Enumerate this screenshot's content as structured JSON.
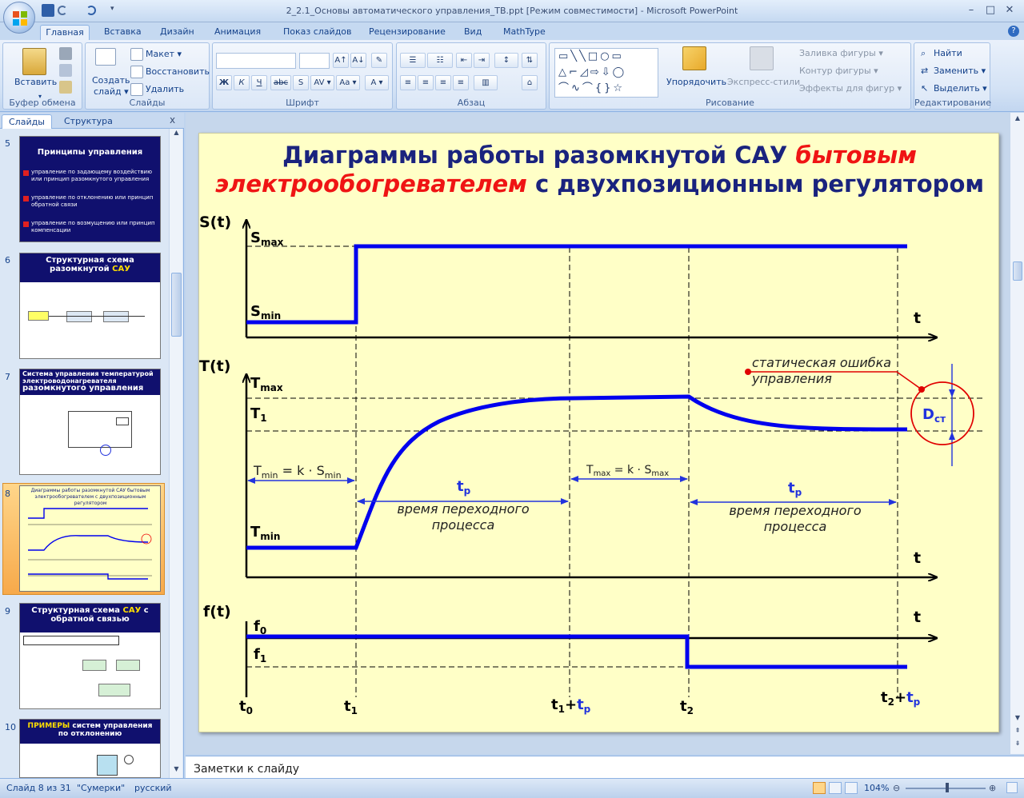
{
  "window": {
    "title": "2_2.1_Основы автоматического управления_ТВ.ppt [Режим совместимости] - Microsoft PowerPoint",
    "controls": [
      "–",
      "□",
      "✕"
    ]
  },
  "ribbon_tabs": [
    "Главная",
    "Вставка",
    "Дизайн",
    "Анимация",
    "Показ слайдов",
    "Рецензирование",
    "Вид",
    "MathType"
  ],
  "ribbon": {
    "clipboard": {
      "paste": "Вставить",
      "label": "Буфер обмена"
    },
    "slides": {
      "new_slide": "Создать",
      "new_slide2": "слайд ▾",
      "layout": "Макет ▾",
      "reset": "Восстановить",
      "delete": "Удалить",
      "label": "Слайды"
    },
    "font": {
      "bold": "Ж",
      "italic": "К",
      "underline": "Ч",
      "strike": "abc",
      "shadow": "S",
      "spacing": "AV ▾",
      "case": "Aa ▾",
      "color": "A ▾",
      "grow": "A↑",
      "shrink": "A↓",
      "clear": "✎",
      "label": "Шрифт"
    },
    "paragraph": {
      "label": "Абзац"
    },
    "drawing": {
      "arrange": "Упорядочить",
      "quick_styles": "Экспресс-стили",
      "fill": "Заливка фигуры ▾",
      "outline": "Контур фигуры ▾",
      "effects": "Эффекты для фигур ▾",
      "label": "Рисование"
    },
    "editing": {
      "find": "Найти",
      "replace": "Заменить ▾",
      "select": "Выделить ▾",
      "label": "Редактирование"
    }
  },
  "panel": {
    "tabs": [
      "Слайды",
      "Структура"
    ],
    "close": "x",
    "thumbnails": [
      {
        "num": "5",
        "title": "Принципы управления",
        "items": [
          "управление по задающему воздействию или принцип разомкнутого управления",
          "управление по отклонению или принцип обратной связи",
          "управление по возмущению или принцип компенсации"
        ]
      },
      {
        "num": "6",
        "title": "Структурная схема разомкнутой",
        "title_hl": "САУ"
      },
      {
        "num": "7",
        "title": "Система управления температурой электроводонагревателя",
        "title2": "разомкнутого управления"
      },
      {
        "num": "8",
        "title": "Диаграммы работы разомкнутой САУ бытовым электрообогревателем с двухпозиционным регулятором"
      },
      {
        "num": "9",
        "title": "Структурная схема",
        "title_hl": "САУ",
        "title2": "с обратной связью"
      },
      {
        "num": "10",
        "title_hl": "ПРИМЕРЫ",
        "title": "систем управления по отклонению"
      }
    ]
  },
  "slide": {
    "title_line1_a": "Диаграммы работы разомкнутой САУ ",
    "title_line1_b": "бытовым",
    "title_line2_a": "электрообогревателем",
    "title_line2_b": " с двухпозиционным регулятором",
    "axis_labels": {
      "s": "S(t)",
      "t_temp": "T(t)",
      "f": "f(t)",
      "t": "t"
    },
    "s_max": "S",
    "s_max_sub": "max",
    "s_min": "S",
    "s_min_sub": "min",
    "T_max": "T",
    "T_max_sub": "max",
    "T_1": "T",
    "T_1_sub": "1",
    "T_min": "T",
    "T_min_sub": "min",
    "f_0": "f",
    "f_0_sub": "0",
    "f_1": "f",
    "f_1_sub": "1",
    "formula_min": "T",
    "formula_min_sub": "min",
    "formula_min_mid": " = k · S",
    "formula_min_sub2": "min",
    "formula_max": "T",
    "formula_max_sub": "max",
    "formula_max_mid": " = k · S",
    "formula_max_sub2": "max",
    "tp": "t",
    "tp_sub": "p",
    "transient_1": "время переходного",
    "transient_2": "процесса",
    "static_error_1": "статическая ошибка",
    "static_error_2": "управления",
    "d_st": "D",
    "d_st_sub": "ст",
    "time_labels": {
      "t0": "t",
      "t0_sub": "0",
      "t1": "t",
      "t1_sub": "1",
      "t1tp": "t",
      "t1tp_sub": "1",
      "plus": "+",
      "t2": "t",
      "t2_sub": "2",
      "t2tp": "t",
      "t2tp_sub": "2"
    }
  },
  "notes": "Заметки к слайду",
  "status": {
    "slide": "Слайд 8 из 31",
    "theme": "\"Сумерки\"",
    "lang": "русский",
    "zoom": "104%"
  },
  "colors": {
    "curve": "#0000ee",
    "title": "#1a237e",
    "accent_red": "#ef1414",
    "slide_bg": "#ffffc7",
    "arrow": "#2233dd"
  }
}
